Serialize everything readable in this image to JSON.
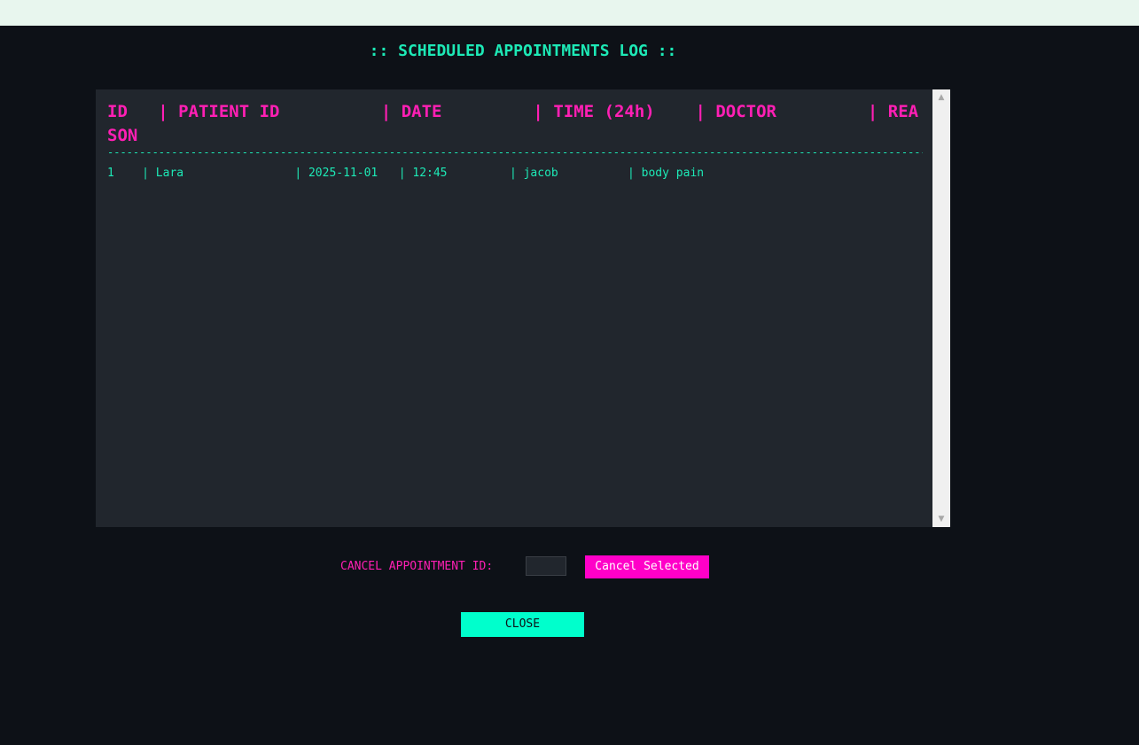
{
  "window": {
    "title": ":: SCHEDULED APPOINTMENTS LOG ::"
  },
  "log": {
    "header": "ID   | PATIENT ID          | DATE         | TIME (24h)    | DOCTOR         | REASON",
    "divider": "----------------------------------------------------------------------------------------------------------------------------------------",
    "columns": [
      "ID",
      "PATIENT ID",
      "DATE",
      "TIME (24h)",
      "DOCTOR",
      "REASON"
    ],
    "rows": [
      {
        "text": "1    | Lara                | 2025-11-01   | 12:45         | jacob          | body pain",
        "id": "1",
        "patient_id": "Lara",
        "date": "2025-11-01",
        "time": "12:45",
        "doctor": "jacob",
        "reason": "body pain"
      }
    ]
  },
  "cancel": {
    "label": "CANCEL APPOINTMENT ID:",
    "input_value": "",
    "button_label": "Cancel Selected"
  },
  "close": {
    "button_label": "CLOSE"
  },
  "scrollbar": {
    "up_icon": "▲",
    "down_icon": "▼"
  },
  "colors": {
    "background": "#0d1117",
    "panel": "#21262d",
    "accent_cyan": "#1de9b6",
    "accent_magenta": "#ff1fb4",
    "cancel_button": "#ff00c8",
    "close_button": "#00ffcc",
    "titlebar": "#e8f6ee"
  }
}
